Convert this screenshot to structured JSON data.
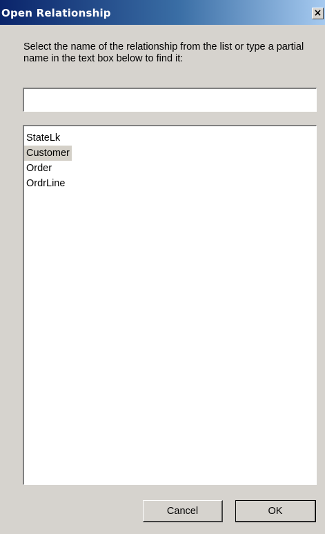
{
  "window": {
    "title": "Open Relationship",
    "close_glyph": "×"
  },
  "instructions": "Select the name of the relationship from the list or type a partial name in the text box below to find it:",
  "search": {
    "value": "",
    "placeholder": ""
  },
  "list": {
    "items": [
      "StateLk",
      "Customer",
      "Order",
      "OrdrLine"
    ],
    "selected": "Customer"
  },
  "buttons": {
    "cancel": "Cancel",
    "ok": "OK"
  },
  "colors": {
    "titlebar_start": "#0a246a",
    "titlebar_end": "#a6caf0",
    "dialog_face": "#d6d3ce",
    "selection": "#d4d0c8"
  }
}
